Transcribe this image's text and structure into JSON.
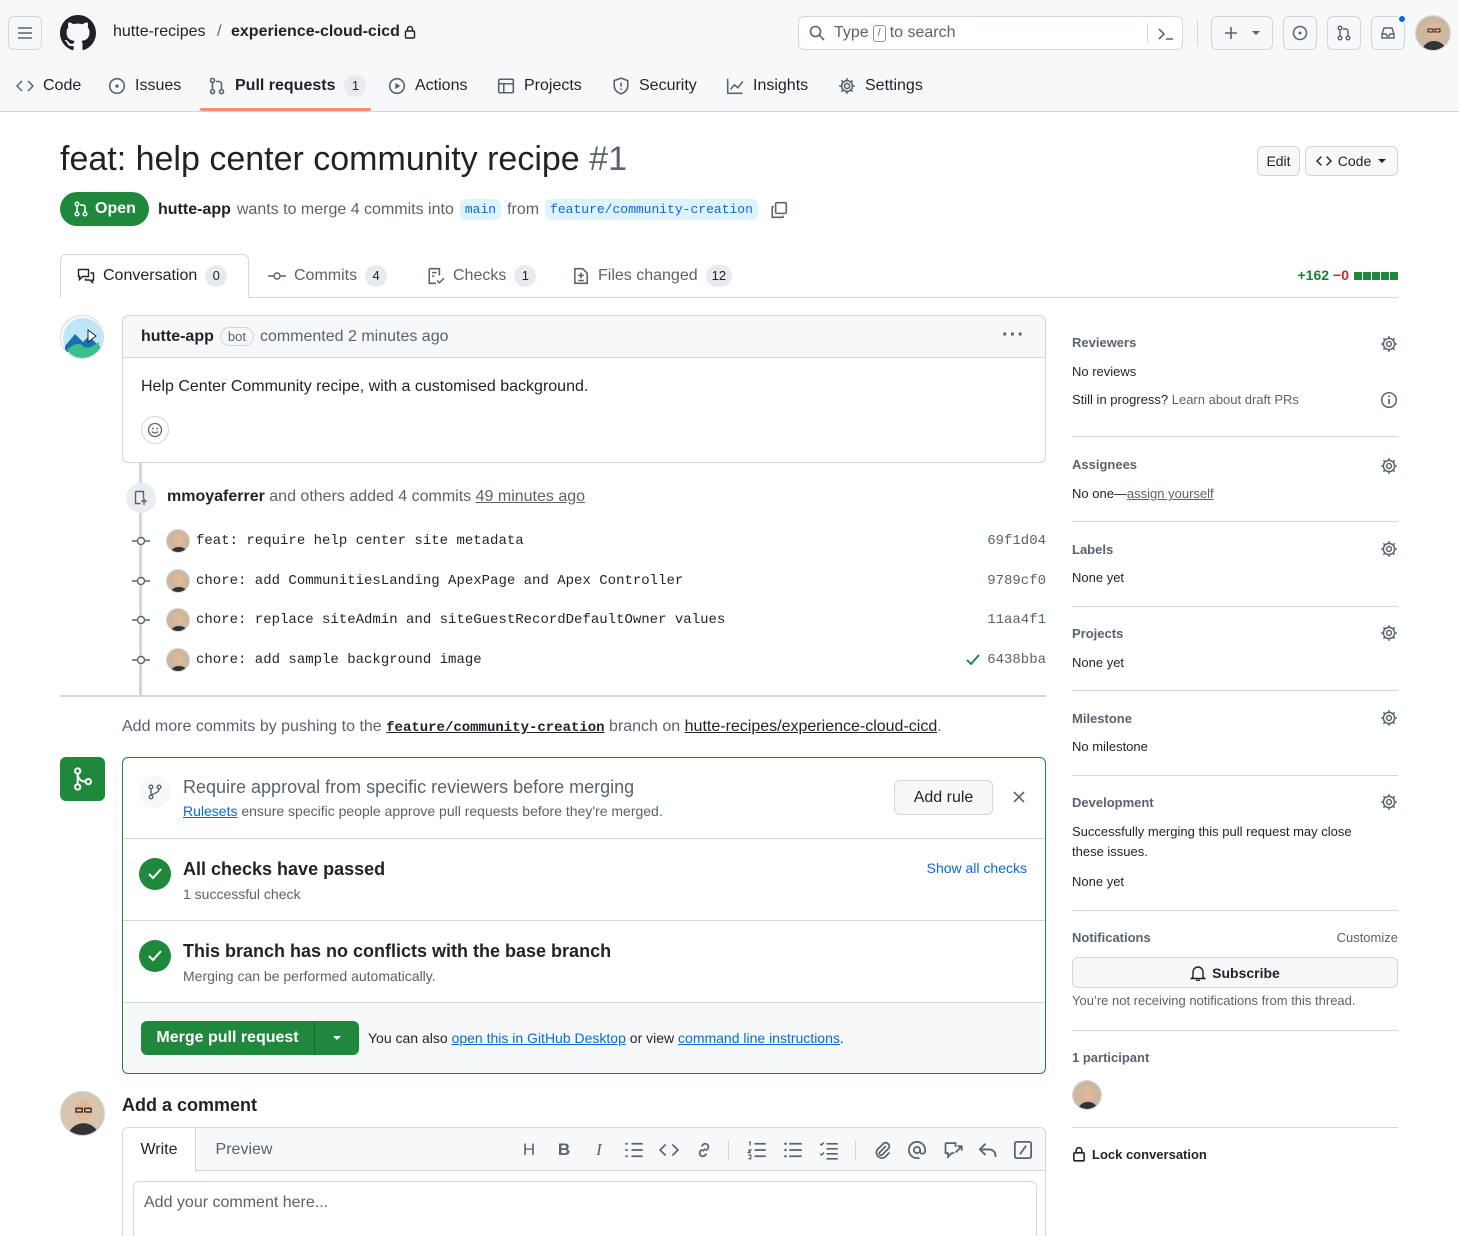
{
  "header": {
    "owner": "hutte-recipes",
    "separator": "/",
    "repo": "experience-cloud-cicd",
    "search_before": "Type",
    "search_key": "/",
    "search_after": "to search"
  },
  "repo_nav": [
    {
      "label": "Code",
      "icon": "code-icon"
    },
    {
      "label": "Issues",
      "icon": "issue-icon"
    },
    {
      "label": "Pull requests",
      "icon": "pull-request-icon",
      "count": "1",
      "active": true
    },
    {
      "label": "Actions",
      "icon": "play-icon"
    },
    {
      "label": "Projects",
      "icon": "table-icon"
    },
    {
      "label": "Security",
      "icon": "shield-icon"
    },
    {
      "label": "Insights",
      "icon": "graph-icon"
    },
    {
      "label": "Settings",
      "icon": "gear-icon"
    }
  ],
  "pr": {
    "title": "feat: help center community recipe",
    "number": "#1",
    "edit_label": "Edit",
    "code_label": "Code",
    "state": "Open",
    "author": "hutte-app",
    "merge_text": "wants to merge 4 commits into",
    "base": "main",
    "from_text": "from",
    "head": "feature/community-creation"
  },
  "pr_tabs": [
    {
      "label": "Conversation",
      "count": "0",
      "icon": "comment-icon"
    },
    {
      "label": "Commits",
      "count": "4",
      "icon": "commit-icon"
    },
    {
      "label": "Checks",
      "count": "1",
      "icon": "checklist-icon"
    },
    {
      "label": "Files changed",
      "count": "12",
      "icon": "file-diff-icon"
    }
  ],
  "diffstat": {
    "additions": "+162",
    "deletions": "−0"
  },
  "comment": {
    "author": "hutte-app",
    "badge": "bot",
    "action": "commented 2 minutes ago",
    "body": "Help Center Community recipe, with a customised background."
  },
  "push_event": {
    "actor": "mmoyaferrer",
    "text": "and others added 4 commits",
    "time": "49 minutes ago"
  },
  "commits": [
    {
      "message": "feat: require help center site metadata",
      "sha": "69f1d04",
      "checked": false
    },
    {
      "message": "chore: add CommunitiesLanding ApexPage and Apex Controller",
      "sha": "9789cf0",
      "checked": false
    },
    {
      "message": "chore: replace siteAdmin and siteGuestRecordDefaultOwner values",
      "sha": "11aa4f1",
      "checked": false
    },
    {
      "message": "chore: add sample background image",
      "sha": "6438bba",
      "checked": true
    }
  ],
  "more_commits": {
    "prefix": "Add more commits by pushing to the",
    "branch": "feature/community-creation",
    "middle": "branch on",
    "repo": "hutte-recipes/experience-cloud-cicd",
    "suffix": "."
  },
  "merge_box": {
    "rule_title": "Require approval from specific reviewers before merging",
    "rule_link": "Rulesets",
    "rule_desc": "ensure specific people approve pull requests before they're merged.",
    "add_rule": "Add rule",
    "checks_title": "All checks have passed",
    "checks_sub": "1 successful check",
    "show_checks": "Show all checks",
    "conflicts_title": "This branch has no conflicts with the base branch",
    "conflicts_sub": "Merging can be performed automatically.",
    "merge_button": "Merge pull request",
    "alt_prefix": "You can also",
    "alt_link1": "open this in GitHub Desktop",
    "alt_middle": "or view",
    "alt_link2": "command line instructions",
    "alt_suffix": "."
  },
  "add_comment": {
    "title": "Add a comment",
    "write_tab": "Write",
    "preview_tab": "Preview",
    "placeholder": "Add your comment here..."
  },
  "sidebar": {
    "reviewers": {
      "heading": "Reviewers",
      "value": "No reviews",
      "draft_q": "Still in progress?",
      "draft_link": "Learn about draft PRs"
    },
    "assignees": {
      "heading": "Assignees",
      "value": "No one—",
      "link": "assign yourself"
    },
    "labels": {
      "heading": "Labels",
      "value": "None yet"
    },
    "projects": {
      "heading": "Projects",
      "value": "None yet"
    },
    "milestone": {
      "heading": "Milestone",
      "value": "No milestone"
    },
    "development": {
      "heading": "Development",
      "desc1": "Successfully merging this pull request may close",
      "desc2": "these issues.",
      "value": "None yet"
    },
    "notifications": {
      "heading": "Notifications",
      "customize": "Customize",
      "subscribe": "Subscribe",
      "note": "You’re not receiving notifications from this thread."
    },
    "participants": {
      "heading": "1 participant"
    },
    "lock": "Lock conversation"
  },
  "colors": {
    "accent": "#0969da",
    "success": "#1f883d",
    "danger": "#d1242f",
    "tab_underline": "#fd8c73"
  }
}
